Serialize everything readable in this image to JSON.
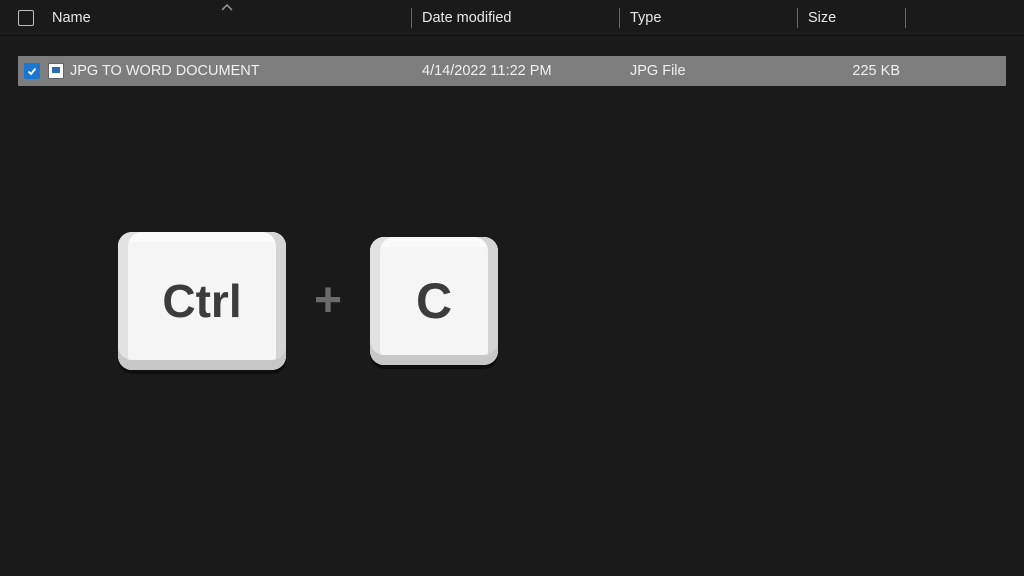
{
  "columns": {
    "name": "Name",
    "date": "Date modified",
    "type": "Type",
    "size": "Size"
  },
  "sort": {
    "column": "name",
    "direction": "asc"
  },
  "files": [
    {
      "selected": true,
      "name": "JPG TO WORD DOCUMENT",
      "date": "4/14/2022 11:22 PM",
      "type": "JPG File",
      "size": "225 KB"
    }
  ],
  "shortcut": {
    "keys": [
      "Ctrl",
      "C"
    ],
    "joiner": "+"
  }
}
